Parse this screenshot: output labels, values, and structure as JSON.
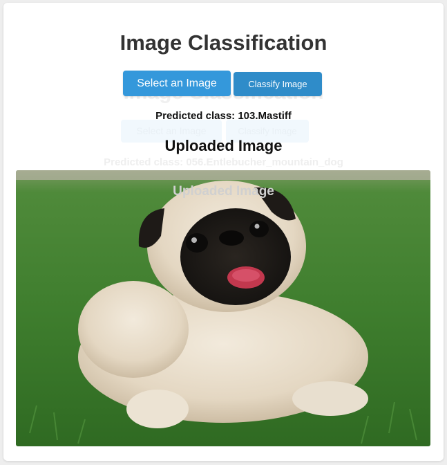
{
  "page": {
    "title": "Image Classification",
    "select_button_label": "Select an Image",
    "classify_button_label": "Classify Image",
    "predicted_text": "Predicted class: 103.Mastiff",
    "uploaded_heading": "Uploaded Image"
  },
  "ghost": {
    "title": "Image Classification",
    "select_button_label": "Select an Image",
    "classify_button_label": "Classify Image",
    "predicted_text": "Predicted class: 056.Entlebucher_mountain_dog",
    "uploaded_heading": "Uploaded Image"
  },
  "image": {
    "subject": "pug lying on grass"
  },
  "colors": {
    "primary": "#3498db",
    "primary_dark": "#2f8cc9",
    "heading": "#333333"
  }
}
